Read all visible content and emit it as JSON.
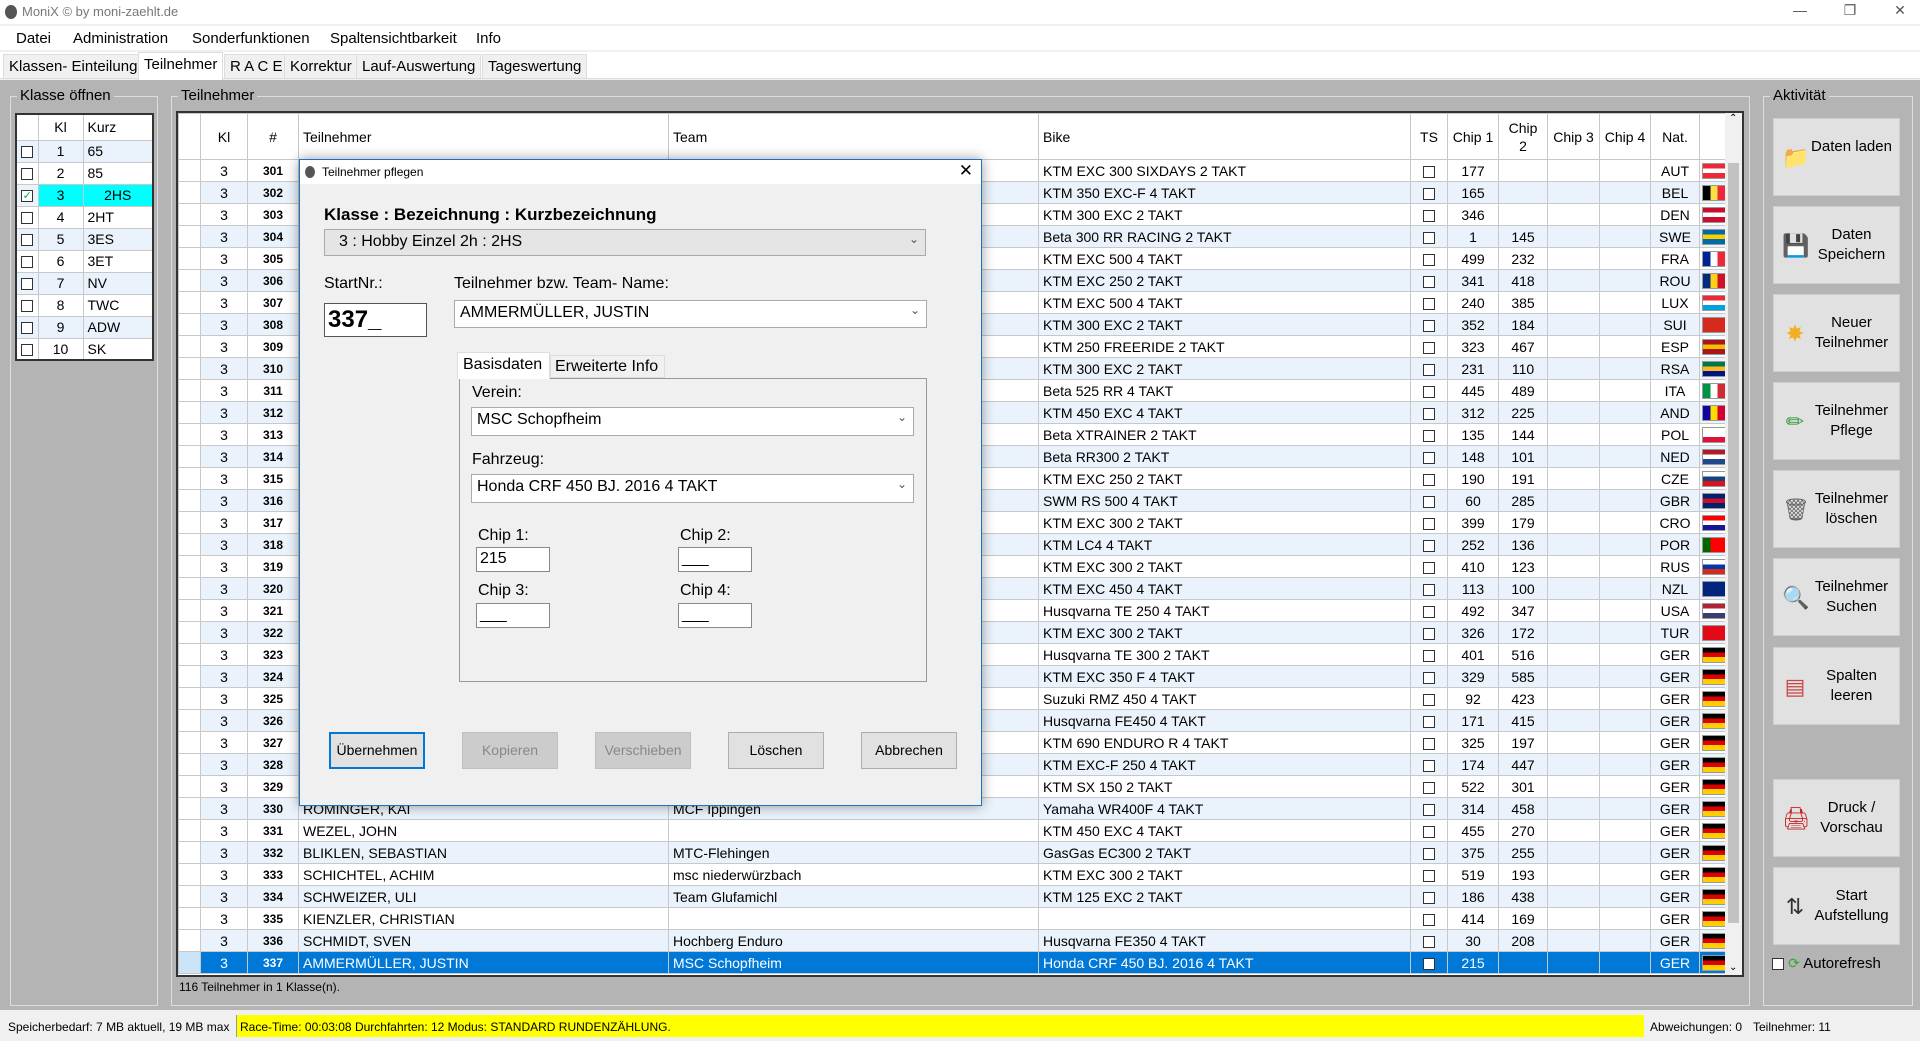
{
  "app": {
    "title": "MoniX © by moni-zaehlt.de"
  },
  "menu": [
    "Datei",
    "Administration",
    "Sonderfunktionen",
    "Spaltensichtbarkeit",
    "Info"
  ],
  "tabs": [
    {
      "label": "Klassen- Einteilung"
    },
    {
      "label": "Teilnehmer",
      "active": true
    },
    {
      "label": "R A C E"
    },
    {
      "label": "Korrektur"
    },
    {
      "label": "Lauf-Auswertung"
    },
    {
      "label": "Tageswertung"
    }
  ],
  "classes": {
    "title": "Klasse öffnen",
    "headers": [
      "Kl",
      "Kurz"
    ],
    "rows": [
      {
        "kl": "1",
        "kurz": "65",
        "checked": false
      },
      {
        "kl": "2",
        "kurz": "85",
        "checked": false
      },
      {
        "kl": "3",
        "kurz": "2HS",
        "checked": true
      },
      {
        "kl": "4",
        "kurz": "2HT",
        "checked": false
      },
      {
        "kl": "5",
        "kurz": "3ES",
        "checked": false
      },
      {
        "kl": "6",
        "kurz": "3ET",
        "checked": false
      },
      {
        "kl": "7",
        "kurz": "NV",
        "checked": false
      },
      {
        "kl": "8",
        "kurz": "TWC",
        "checked": false
      },
      {
        "kl": "9",
        "kurz": "ADW",
        "checked": false
      },
      {
        "kl": "10",
        "kurz": "SK",
        "checked": false
      }
    ]
  },
  "participants": {
    "title": "Teilnehmer",
    "headers": [
      "Kl",
      "#",
      "Teilnehmer",
      "Team",
      "Bike",
      "TS",
      "Chip 1",
      "Chip 2",
      "Chip 3",
      "Chip 4",
      "Nat."
    ],
    "footer": "116 Teilnehmer in 1 Klasse(n).",
    "rows": [
      [
        "3",
        "301",
        "",
        "",
        "KTM EXC 300 SIXDAYS 2 TAKT",
        "177",
        "",
        "AUT"
      ],
      [
        "3",
        "302",
        "",
        "",
        "KTM 350 EXC-F 4 TAKT",
        "165",
        "",
        "BEL"
      ],
      [
        "3",
        "303",
        "",
        "",
        "KTM 300 EXC 2 TAKT",
        "346",
        "",
        "DEN"
      ],
      [
        "3",
        "304",
        "",
        "",
        "Beta 300 RR RACING 2 TAKT",
        "1",
        "145",
        "SWE"
      ],
      [
        "3",
        "305",
        "",
        "",
        "KTM EXC 500 4 TAKT",
        "499",
        "232",
        "FRA"
      ],
      [
        "3",
        "306",
        "",
        "",
        "KTM EXC 250 2 TAKT",
        "341",
        "418",
        "ROU"
      ],
      [
        "3",
        "307",
        "",
        "",
        "KTM EXC 500 4 TAKT",
        "240",
        "385",
        "LUX"
      ],
      [
        "3",
        "308",
        "",
        "",
        "KTM 300 EXC 2 TAKT",
        "352",
        "184",
        "SUI"
      ],
      [
        "3",
        "309",
        "",
        "",
        "KTM 250 FREERIDE 2 TAKT",
        "323",
        "467",
        "ESP"
      ],
      [
        "3",
        "310",
        "",
        "",
        "KTM 300 EXC 2 TAKT",
        "231",
        "110",
        "RSA"
      ],
      [
        "3",
        "311",
        "",
        "",
        "Beta 525 RR 4 TAKT",
        "445",
        "489",
        "ITA"
      ],
      [
        "3",
        "312",
        "",
        "",
        "KTM 450 EXC 4 TAKT",
        "312",
        "225",
        "AND"
      ],
      [
        "3",
        "313",
        "",
        "",
        "Beta XTRAINER 2 TAKT",
        "135",
        "144",
        "POL"
      ],
      [
        "3",
        "314",
        "",
        "",
        "Beta RR300 2 TAKT",
        "148",
        "101",
        "NED"
      ],
      [
        "3",
        "315",
        "",
        "",
        "KTM EXC 250 2 TAKT",
        "190",
        "191",
        "CZE"
      ],
      [
        "3",
        "316",
        "",
        "",
        "SWM RS 500 4 TAKT",
        "60",
        "285",
        "GBR"
      ],
      [
        "3",
        "317",
        "",
        "",
        "KTM EXC 300 2 TAKT",
        "399",
        "179",
        "CRO"
      ],
      [
        "3",
        "318",
        "",
        "",
        "KTM LC4 4 TAKT",
        "252",
        "136",
        "POR"
      ],
      [
        "3",
        "319",
        "",
        "",
        "KTM EXC 300 2 TAKT",
        "410",
        "123",
        "RUS"
      ],
      [
        "3",
        "320",
        "",
        "",
        "KTM EXC 450 4 TAKT",
        "113",
        "100",
        "NZL"
      ],
      [
        "3",
        "321",
        "",
        "",
        "Husqvarna TE 250 4 TAKT",
        "492",
        "347",
        "USA"
      ],
      [
        "3",
        "322",
        "",
        "",
        "KTM EXC 300 2 TAKT",
        "326",
        "172",
        "TUR"
      ],
      [
        "3",
        "323",
        "",
        "",
        "Husqvarna TE 300 2 TAKT",
        "401",
        "516",
        "GER"
      ],
      [
        "3",
        "324",
        "",
        "",
        "KTM EXC 350 F 4 TAKT",
        "329",
        "585",
        "GER"
      ],
      [
        "3",
        "325",
        "",
        "",
        "Suzuki RMZ 450 4 TAKT",
        "92",
        "423",
        "GER"
      ],
      [
        "3",
        "326",
        "",
        "",
        "Husqvarna FE450 4 TAKT",
        "171",
        "415",
        "GER"
      ],
      [
        "3",
        "327",
        "",
        "",
        "KTM 690 ENDURO R 4 TAKT",
        "325",
        "197",
        "GER"
      ],
      [
        "3",
        "328",
        "",
        "",
        "KTM EXC-F 250 4 TAKT",
        "174",
        "447",
        "GER"
      ],
      [
        "3",
        "329",
        "",
        "",
        "KTM SX 150 2 TAKT",
        "522",
        "301",
        "GER"
      ],
      [
        "3",
        "330",
        "ROMINGER, KAI",
        "MCF Ippingen",
        "Yamaha WR400F 4 TAKT",
        "314",
        "458",
        "GER"
      ],
      [
        "3",
        "331",
        "WEZEL, JOHN",
        "",
        "KTM 450 EXC 4 TAKT",
        "455",
        "270",
        "GER"
      ],
      [
        "3",
        "332",
        "BLIKLEN, SEBASTIAN",
        "MTC-Flehingen",
        "GasGas EC300 2 TAKT",
        "375",
        "255",
        "GER"
      ],
      [
        "3",
        "333",
        "SCHICHTEL, ACHIM",
        "msc niederwürzbach",
        "KTM EXC 300 2 TAKT",
        "519",
        "193",
        "GER"
      ],
      [
        "3",
        "334",
        "SCHWEIZER, ULI",
        "Team Glufamichl",
        "KTM 125 EXC 2 TAKT",
        "186",
        "438",
        "GER"
      ],
      [
        "3",
        "335",
        "KIENZLER, CHRISTIAN",
        "",
        "",
        "414",
        "169",
        "GER"
      ],
      [
        "3",
        "336",
        "SCHMIDT, SVEN",
        "Hochberg Enduro",
        "Husqvarna FE350 4 TAKT",
        "30",
        "208",
        "GER"
      ],
      [
        "3",
        "337",
        "AMMERMÜLLER, JUSTIN",
        "MSC Schopfheim",
        "Honda CRF 450 BJ. 2016 4 TAKT",
        "215",
        "",
        "GER"
      ]
    ],
    "selected_row": "337"
  },
  "flags": {
    "AUT": "#ed2939,#fff,#ed2939|v",
    "BEL": "#000,#fae042,#ed2939|h",
    "DEN": "#c8102e,#fff,#c8102e|v",
    "SWE": "#006aa7,#fecc00,#006aa7|v",
    "FRA": "#002395,#fff,#ed2939|h",
    "ROU": "#002b7f,#fcd116,#ce1126|h",
    "LUX": "#ed2939,#fff,#00a1de|v",
    "SUI": "#d52b1e,#d52b1e,#d52b1e|v",
    "ESP": "#aa151b,#f1bf00,#aa151b|v",
    "RSA": "#007749,#ffb81c,#001489|v",
    "ITA": "#009246,#fff,#ce2b37|h",
    "AND": "#10069f,#fedd00,#d50032|h",
    "POL": "#fff,#fff,#dc143c|v",
    "NED": "#ae1c28,#fff,#21468b|v",
    "CZE": "#fff,#11457e,#d7141a|v",
    "GBR": "#012169,#c8102e,#012169|v",
    "CRO": "#ff0000,#fff,#171796|v",
    "POR": "#006600,#ff0000,#ff0000|h",
    "RUS": "#fff,#0039a6,#d52b1e|v",
    "NZL": "#00247d,#00247d,#00247d|v",
    "USA": "#b22234,#fff,#3c3b6e|v",
    "TUR": "#e30a17,#e30a17,#e30a17|v",
    "GER": "#000,#dd0000,#ffce00|v"
  },
  "colors": {
    "selection": "#0078d7",
    "class_highlight": "#00ffff",
    "status_highlight": "#ffff00"
  },
  "actions": {
    "title": "Aktivität",
    "buttons": [
      {
        "label": "Daten laden",
        "icon": "folder-icon"
      },
      {
        "label": "Daten Speichern",
        "icon": "floppy-icon"
      },
      {
        "label": "Neuer Teilnehmer",
        "icon": "star-icon"
      },
      {
        "label": "Teilnehmer Pflege",
        "icon": "pencil-icon"
      },
      {
        "label": "Teilnehmer löschen",
        "icon": "trash-icon"
      },
      {
        "label": "Teilnehmer Suchen",
        "icon": "magnifier-icon"
      },
      {
        "label": "Spalten leeren",
        "icon": "clear-columns-icon"
      },
      {
        "label": "Druck / Vorschau",
        "icon": "pdf-printer-icon"
      },
      {
        "label": "Start Aufstellung",
        "icon": "start-order-icon"
      }
    ],
    "autorefresh": {
      "label": "Autorefresh",
      "checked": false
    }
  },
  "dialog": {
    "title": "Teilnehmer pflegen",
    "class_heading": "Klasse : Bezeichnung : Kurzbezeichnung",
    "class_value": "3 : Hobby Einzel 2h : 2HS",
    "startnr_label": "StartNr.:",
    "startnr_value": "337_",
    "name_label": "Teilnehmer bzw. Team- Name:",
    "name_value": "AMMERMÜLLER, JUSTIN",
    "tabs": [
      "Basisdaten",
      "Erweiterte Info"
    ],
    "verein_label": "Verein:",
    "verein_value": "MSC Schopfheim",
    "fahrzeug_label": "Fahrzeug:",
    "fahrzeug_value": "Honda CRF 450 BJ. 2016 4 TAKT",
    "chip1_label": "Chip 1:",
    "chip1_value": "215",
    "chip2_label": "Chip 2:",
    "chip2_value": "___",
    "chip3_label": "Chip 3:",
    "chip3_value": "___",
    "chip4_label": "Chip 4:",
    "chip4_value": "___",
    "buttons": [
      {
        "label": "Übernehmen",
        "enabled": true
      },
      {
        "label": "Kopieren",
        "enabled": false
      },
      {
        "label": "Verschieben",
        "enabled": false
      },
      {
        "label": "Löschen",
        "enabled": true
      },
      {
        "label": "Abbrechen",
        "enabled": true
      }
    ]
  },
  "status": {
    "memory": "Speicherbedarf: 7 MB aktuell, 19 MB max",
    "race": "Race-Time: 00:03:08  Durchfahrten: 12  Modus: STANDARD RUNDENZÄHLUNG.",
    "deviations": "Abweichungen: 0",
    "participants": "Teilnehmer: 11"
  }
}
